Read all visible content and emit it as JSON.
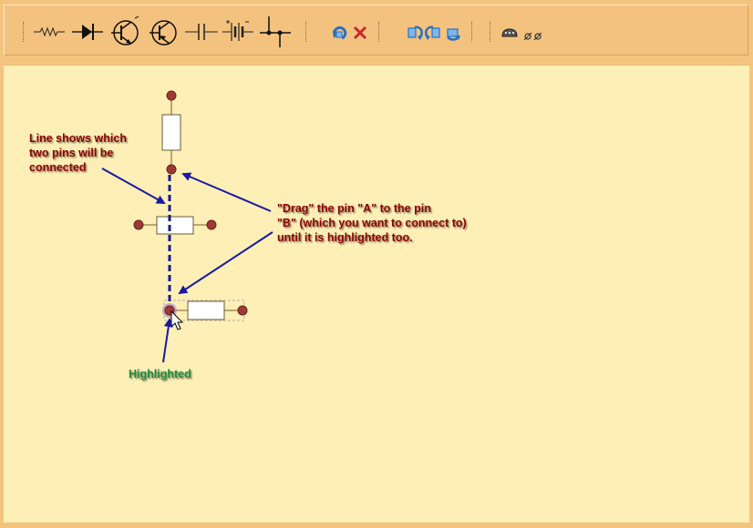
{
  "toolbar": {
    "groups": [
      {
        "name": "components",
        "tools": [
          "resistor-tool",
          "diode-tool",
          "npn-transistor-tool",
          "pnp-transistor-tool",
          "capacitor-tool",
          "battery-tool",
          "wire-junction-tool"
        ]
      },
      {
        "name": "edit",
        "tools": [
          "rotate-tool",
          "delete-tool"
        ]
      },
      {
        "name": "transform",
        "tools": [
          "flip-horizontal-tool",
          "flip-vertical-tool",
          "rotate-back-tool"
        ]
      },
      {
        "name": "misc",
        "tools": [
          "probe-tool",
          "pin-tool"
        ]
      }
    ]
  },
  "annotations": {
    "line_note": [
      "Line shows which",
      "two pins will be",
      "connected"
    ],
    "drag_note": [
      "\"Drag\" the pin \"A\" to the pin",
      "\"B\" (which you want to connect to)",
      "until it is highlighted too."
    ],
    "highlight_note": "Highlighted"
  },
  "colors": {
    "toolbar_bg": "#f3c27f",
    "canvas_bg": "#fdefb6",
    "annotation_text": "#8b0000",
    "highlight_text": "#1f8a3a",
    "arrow": "#1a1aa0",
    "pin": "#9c3b35"
  }
}
